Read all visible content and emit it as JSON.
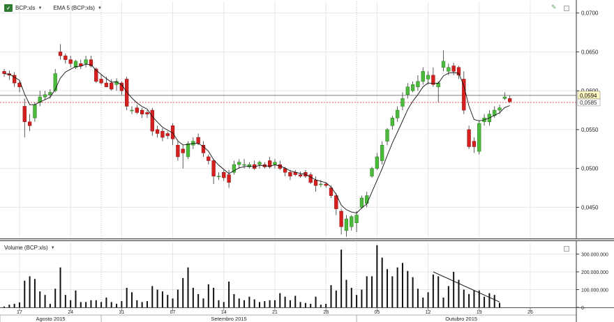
{
  "legend": {
    "symbol": "BCP:xls",
    "indicator": "EMA 5 (BCP:xls)",
    "volume": "Volume (BCP:xls)",
    "icon": "xls-icon"
  },
  "chart_data": [
    {
      "type": "candlestick",
      "title": "",
      "ylim": [
        0.041,
        0.0715
      ],
      "y_ticks": [
        "0,0700",
        "0,0650",
        "0,0600",
        "0,0550",
        "0,0500",
        "0,0450"
      ],
      "y_tick_values": [
        0.07,
        0.065,
        0.06,
        0.055,
        0.05,
        0.045
      ],
      "last_price": "0,0594",
      "last_price_value": 0.0594,
      "ref_price": "0,0585",
      "ref_price_value": 0.0585,
      "series": [
        {
          "name": "BCP:xls",
          "ohlc": [
            [
              0.0625,
              0.0628,
              0.0618,
              0.0622
            ],
            [
              0.0622,
              0.0626,
              0.0614,
              0.062
            ],
            [
              0.062,
              0.0624,
              0.0605,
              0.061
            ],
            [
              0.061,
              0.0612,
              0.0598,
              0.0605
            ],
            [
              0.058,
              0.059,
              0.054,
              0.056
            ],
            [
              0.056,
              0.057,
              0.0548,
              0.0555
            ],
            [
              0.0565,
              0.0585,
              0.056,
              0.0582
            ],
            [
              0.0585,
              0.06,
              0.058,
              0.0592
            ],
            [
              0.0592,
              0.06,
              0.0588,
              0.0595
            ],
            [
              0.0595,
              0.0602,
              0.059,
              0.0598
            ],
            [
              0.06,
              0.0628,
              0.0598,
              0.0622
            ],
            [
              0.065,
              0.066,
              0.064,
              0.0645
            ],
            [
              0.0645,
              0.0648,
              0.0635,
              0.064
            ],
            [
              0.064,
              0.0645,
              0.063,
              0.0635
            ],
            [
              0.063,
              0.064,
              0.0628,
              0.0638
            ],
            [
              0.0635,
              0.064,
              0.0628,
              0.0632
            ],
            [
              0.0635,
              0.0645,
              0.063,
              0.064
            ],
            [
              0.064,
              0.0645,
              0.063,
              0.0632
            ],
            [
              0.0628,
              0.063,
              0.061,
              0.0612
            ],
            [
              0.0615,
              0.062,
              0.0608,
              0.061
            ],
            [
              0.061,
              0.0618,
              0.0605,
              0.0605
            ],
            [
              0.061,
              0.0615,
              0.06,
              0.0602
            ],
            [
              0.0608,
              0.0616,
              0.06,
              0.0612
            ],
            [
              0.061,
              0.0612,
              0.0595,
              0.06
            ],
            [
              0.0615,
              0.0618,
              0.0575,
              0.058
            ],
            [
              0.0575,
              0.058,
              0.057,
              0.0575
            ],
            [
              0.0578,
              0.0582,
              0.057,
              0.0572
            ],
            [
              0.0575,
              0.0578,
              0.0565,
              0.057
            ],
            [
              0.0572,
              0.0575,
              0.0565,
              0.057
            ],
            [
              0.0575,
              0.0578,
              0.0542,
              0.0548
            ],
            [
              0.055,
              0.0555,
              0.054,
              0.0545
            ],
            [
              0.0548,
              0.0552,
              0.0535,
              0.054
            ],
            [
              0.0545,
              0.0548,
              0.0538,
              0.0542
            ],
            [
              0.0555,
              0.0558,
              0.053,
              0.0538
            ],
            [
              0.053,
              0.0535,
              0.051,
              0.0515
            ],
            [
              0.0525,
              0.053,
              0.05,
              0.052
            ],
            [
              0.0515,
              0.0535,
              0.0512,
              0.0532
            ],
            [
              0.053,
              0.054,
              0.0525,
              0.0535
            ],
            [
              0.054,
              0.0545,
              0.053,
              0.0532
            ],
            [
              0.053,
              0.0535,
              0.0515,
              0.052
            ],
            [
              0.0515,
              0.0518,
              0.0505,
              0.051
            ],
            [
              0.051,
              0.0512,
              0.048,
              0.049
            ],
            [
              0.049,
              0.0495,
              0.0485,
              0.049
            ],
            [
              0.0495,
              0.0498,
              0.0484,
              0.0488
            ],
            [
              0.0492,
              0.0498,
              0.0475,
              0.0482
            ],
            [
              0.0495,
              0.051,
              0.0492,
              0.0505
            ],
            [
              0.0505,
              0.0512,
              0.05,
              0.0508
            ],
            [
              0.0505,
              0.0512,
              0.05,
              0.0505
            ],
            [
              0.0502,
              0.0508,
              0.05,
              0.0505
            ],
            [
              0.0505,
              0.051,
              0.0498,
              0.05
            ],
            [
              0.0505,
              0.051,
              0.05,
              0.0508
            ],
            [
              0.0505,
              0.0508,
              0.05,
              0.0502
            ],
            [
              0.051,
              0.0515,
              0.05,
              0.0502
            ],
            [
              0.0505,
              0.0512,
              0.05,
              0.0508
            ],
            [
              0.0505,
              0.051,
              0.0498,
              0.05
            ],
            [
              0.05,
              0.0502,
              0.049,
              0.0495
            ],
            [
              0.0495,
              0.0498,
              0.0485,
              0.049
            ],
            [
              0.0495,
              0.0498,
              0.049,
              0.0492
            ],
            [
              0.0492,
              0.0496,
              0.0488,
              0.049
            ],
            [
              0.0495,
              0.0498,
              0.0488,
              0.049
            ],
            [
              0.0492,
              0.0495,
              0.048,
              0.0482
            ],
            [
              0.0485,
              0.049,
              0.047,
              0.0478
            ],
            [
              0.048,
              0.0485,
              0.0476,
              0.048
            ],
            [
              0.048,
              0.0482,
              0.0475,
              0.0478
            ],
            [
              0.0475,
              0.0478,
              0.0462,
              0.0465
            ],
            [
              0.0465,
              0.0468,
              0.044,
              0.0448
            ],
            [
              0.0445,
              0.0448,
              0.0415,
              0.0425
            ],
            [
              0.042,
              0.044,
              0.0412,
              0.0435
            ],
            [
              0.0425,
              0.044,
              0.042,
              0.0438
            ],
            [
              0.043,
              0.0445,
              0.0418,
              0.044
            ],
            [
              0.045,
              0.0465,
              0.0448,
              0.0462
            ],
            [
              0.0455,
              0.047,
              0.045,
              0.0465
            ],
            [
              0.049,
              0.0502,
              0.0488,
              0.05
            ],
            [
              0.05,
              0.052,
              0.0498,
              0.0515
            ],
            [
              0.051,
              0.0535,
              0.0505,
              0.053
            ],
            [
              0.0535,
              0.0552,
              0.053,
              0.055
            ],
            [
              0.0555,
              0.0568,
              0.055,
              0.0565
            ],
            [
              0.0565,
              0.058,
              0.056,
              0.0575
            ],
            [
              0.058,
              0.0598,
              0.0575,
              0.059
            ],
            [
              0.0595,
              0.061,
              0.059,
              0.0605
            ],
            [
              0.06,
              0.0612,
              0.0598,
              0.0608
            ],
            [
              0.0605,
              0.062,
              0.06,
              0.0612
            ],
            [
              0.0612,
              0.063,
              0.0608,
              0.0625
            ],
            [
              0.0615,
              0.0625,
              0.0608,
              0.062
            ],
            [
              0.062,
              0.063,
              0.0605,
              0.0608
            ],
            [
              0.0605,
              0.0612,
              0.0585,
              0.061
            ],
            [
              0.063,
              0.0652,
              0.0625,
              0.0638
            ],
            [
              0.0625,
              0.0635,
              0.062,
              0.063
            ],
            [
              0.0632,
              0.0636,
              0.062,
              0.0625
            ],
            [
              0.063,
              0.0632,
              0.0615,
              0.062
            ],
            [
              0.0615,
              0.0625,
              0.057,
              0.0575
            ],
            [
              0.055,
              0.0555,
              0.0525,
              0.0528
            ],
            [
              0.0535,
              0.054,
              0.052,
              0.0528
            ],
            [
              0.0522,
              0.0562,
              0.0518,
              0.0558
            ],
            [
              0.056,
              0.057,
              0.0555,
              0.0565
            ],
            [
              0.056,
              0.0575,
              0.0555,
              0.057
            ],
            [
              0.0568,
              0.058,
              0.0565,
              0.0575
            ],
            [
              0.0575,
              0.0582,
              0.057,
              0.0578
            ],
            [
              0.059,
              0.0598,
              0.0588,
              0.0592
            ],
            [
              0.059,
              0.0594,
              0.0584,
              0.0586
            ]
          ]
        },
        {
          "name": "EMA 5 (BCP:xls)",
          "role": "ema"
        }
      ]
    },
    {
      "type": "bar",
      "title": "",
      "series_name": "Volume (BCP:xls)",
      "ylim": [
        0,
        365000000
      ],
      "y_ticks": [
        "300.000.000",
        "200.000.000",
        "100.000.000",
        "0"
      ],
      "y_tick_values": [
        300000000,
        200000000,
        100000000,
        0
      ],
      "values": [
        5000000,
        15000000,
        20000000,
        28000000,
        150000000,
        175000000,
        160000000,
        90000000,
        70000000,
        20000000,
        105000000,
        225000000,
        70000000,
        40000000,
        95000000,
        30000000,
        30000000,
        40000000,
        40000000,
        30000000,
        55000000,
        30000000,
        20000000,
        35000000,
        110000000,
        85000000,
        40000000,
        30000000,
        35000000,
        120000000,
        100000000,
        90000000,
        70000000,
        50000000,
        100000000,
        165000000,
        225000000,
        110000000,
        75000000,
        50000000,
        130000000,
        110000000,
        40000000,
        30000000,
        145000000,
        75000000,
        50000000,
        40000000,
        60000000,
        45000000,
        30000000,
        35000000,
        40000000,
        40000000,
        80000000,
        60000000,
        40000000,
        65000000,
        30000000,
        25000000,
        20000000,
        60000000,
        15000000,
        20000000,
        125000000,
        95000000,
        325000000,
        155000000,
        110000000,
        70000000,
        100000000,
        175000000,
        175000000,
        350000000,
        280000000,
        215000000,
        175000000,
        225000000,
        250000000,
        205000000,
        170000000,
        105000000,
        55000000,
        85000000,
        185000000,
        175000000,
        55000000,
        120000000,
        200000000,
        155000000,
        100000000,
        75000000,
        95000000,
        95000000,
        60000000,
        80000000,
        70000000,
        25000000
      ],
      "trendline": {
        "from_index": 84,
        "to_index": 97,
        "from_value": 200000000,
        "to_value": 30000000
      }
    }
  ],
  "x_axis": {
    "day_labels": [
      {
        "label": "17",
        "index": 3
      },
      {
        "label": "24",
        "index": 13
      },
      {
        "label": "31",
        "index": 23
      },
      {
        "label": "07",
        "index": 33
      },
      {
        "label": "14",
        "index": 43
      },
      {
        "label": "21",
        "index": 53
      },
      {
        "label": "28",
        "index": 63
      },
      {
        "label": "05",
        "index": 73
      },
      {
        "label": "12",
        "index": 83
      },
      {
        "label": "19",
        "index": 93
      },
      {
        "label": "26",
        "index": 103
      }
    ],
    "month_labels": [
      {
        "label": "Agosto 2015",
        "start_index": -1,
        "end_index": 19
      },
      {
        "label": "Setembro 2015",
        "start_index": 19,
        "end_index": 69
      },
      {
        "label": "Outubro 2015",
        "start_index": 69,
        "end_index": 110
      }
    ],
    "dotted_vlines_index": [
      19,
      69
    ]
  }
}
